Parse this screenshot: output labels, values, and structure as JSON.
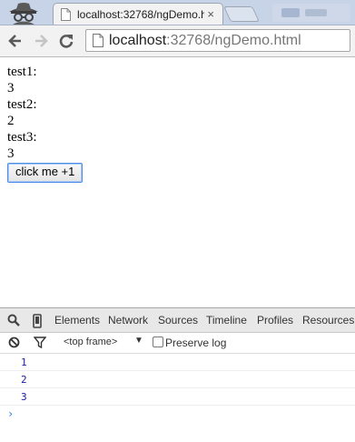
{
  "browser": {
    "tab_title": "localhost:32768/ngDemo.h",
    "tab_close": "×",
    "url_host": "localhost",
    "url_rest": ":32768/ngDemo.html"
  },
  "page": {
    "lines": [
      {
        "label": "test1:",
        "value": "3"
      },
      {
        "label": "test2:",
        "value": "2"
      },
      {
        "label": "test3:",
        "value": "3"
      }
    ],
    "button_label": "click me +1"
  },
  "devtools": {
    "tabs": [
      "Elements",
      "Network",
      "Sources",
      "Timeline",
      "Profiles",
      "Resources"
    ],
    "frame_label": "<top frame>",
    "frame_arrow": "▼",
    "preserve_log_label": "Preserve log",
    "console_lines": [
      "1",
      "2",
      "3"
    ],
    "prompt": "›"
  },
  "icons": {
    "incognito": "incognito-icon",
    "page": "page-icon",
    "back": "back-arrow-icon",
    "forward": "forward-arrow-icon",
    "reload": "reload-icon",
    "search": "search-icon",
    "device": "device-mode-icon",
    "clear": "clear-console-icon",
    "filter": "filter-icon"
  }
}
